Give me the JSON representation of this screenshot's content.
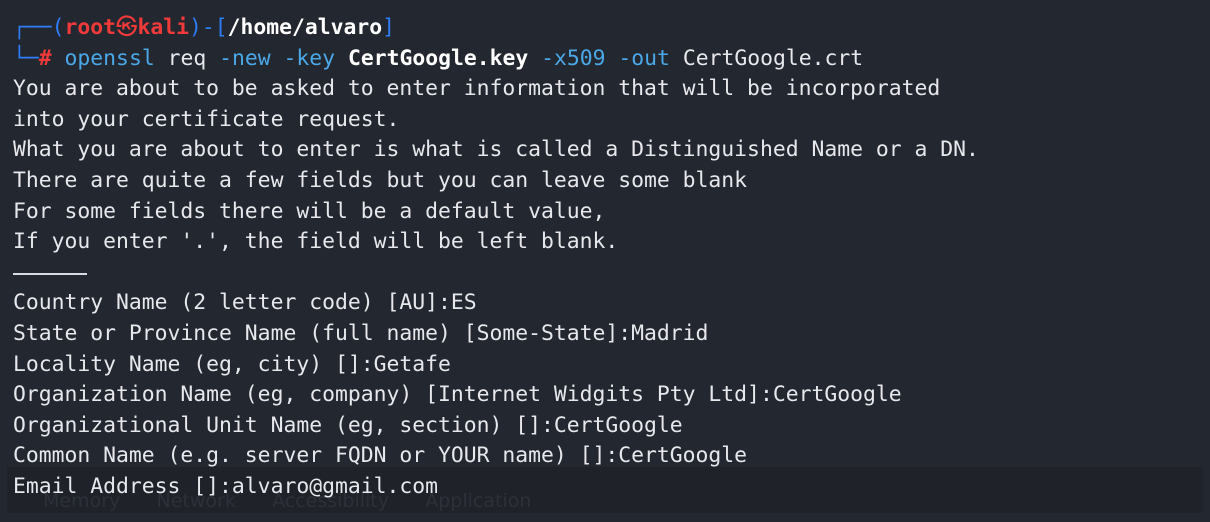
{
  "prompt": {
    "open": "┌──(",
    "user": "root",
    "at": "㉿",
    "host": "kali",
    "close": ")-[",
    "cwd": "/home/alvaro",
    "end": "]",
    "second_prefix": "└─",
    "hash": "#"
  },
  "command": {
    "bin": "openssl",
    "sub": "req",
    "flag_new": "-new",
    "flag_key": "-key",
    "keyfile": "CertGoogle.key",
    "flag_x509": "-x509",
    "flag_out": "-out",
    "outfile": "CertGoogle.crt"
  },
  "output": [
    "You are about to be asked to enter information that will be incorporated",
    "into your certificate request.",
    "What you are about to enter is what is called a Distinguished Name or a DN.",
    "There are quite a few fields but you can leave some blank",
    "For some fields there will be a default value,",
    "If you enter '.', the field will be left blank."
  ],
  "fields": [
    "Country Name (2 letter code) [AU]:ES",
    "State or Province Name (full name) [Some-State]:Madrid",
    "Locality Name (eg, city) []:Getafe",
    "Organization Name (eg, company) [Internet Widgits Pty Ltd]:CertGoogle",
    "Organizational Unit Name (eg, section) []:CertGoogle",
    "Common Name (e.g. server FQDN or YOUR name) []:CertGoogle"
  ],
  "last_field": "Email Address []:alvaro@gmail.com",
  "background_ghost": "Memory      Network      Accessibility      Application",
  "colors": {
    "background": "#23272f",
    "prompt_blue": "#2f7df6",
    "prompt_red": "#f03a3a",
    "command_cyan": "#4aa8e8",
    "text": "#e6e8ec"
  }
}
